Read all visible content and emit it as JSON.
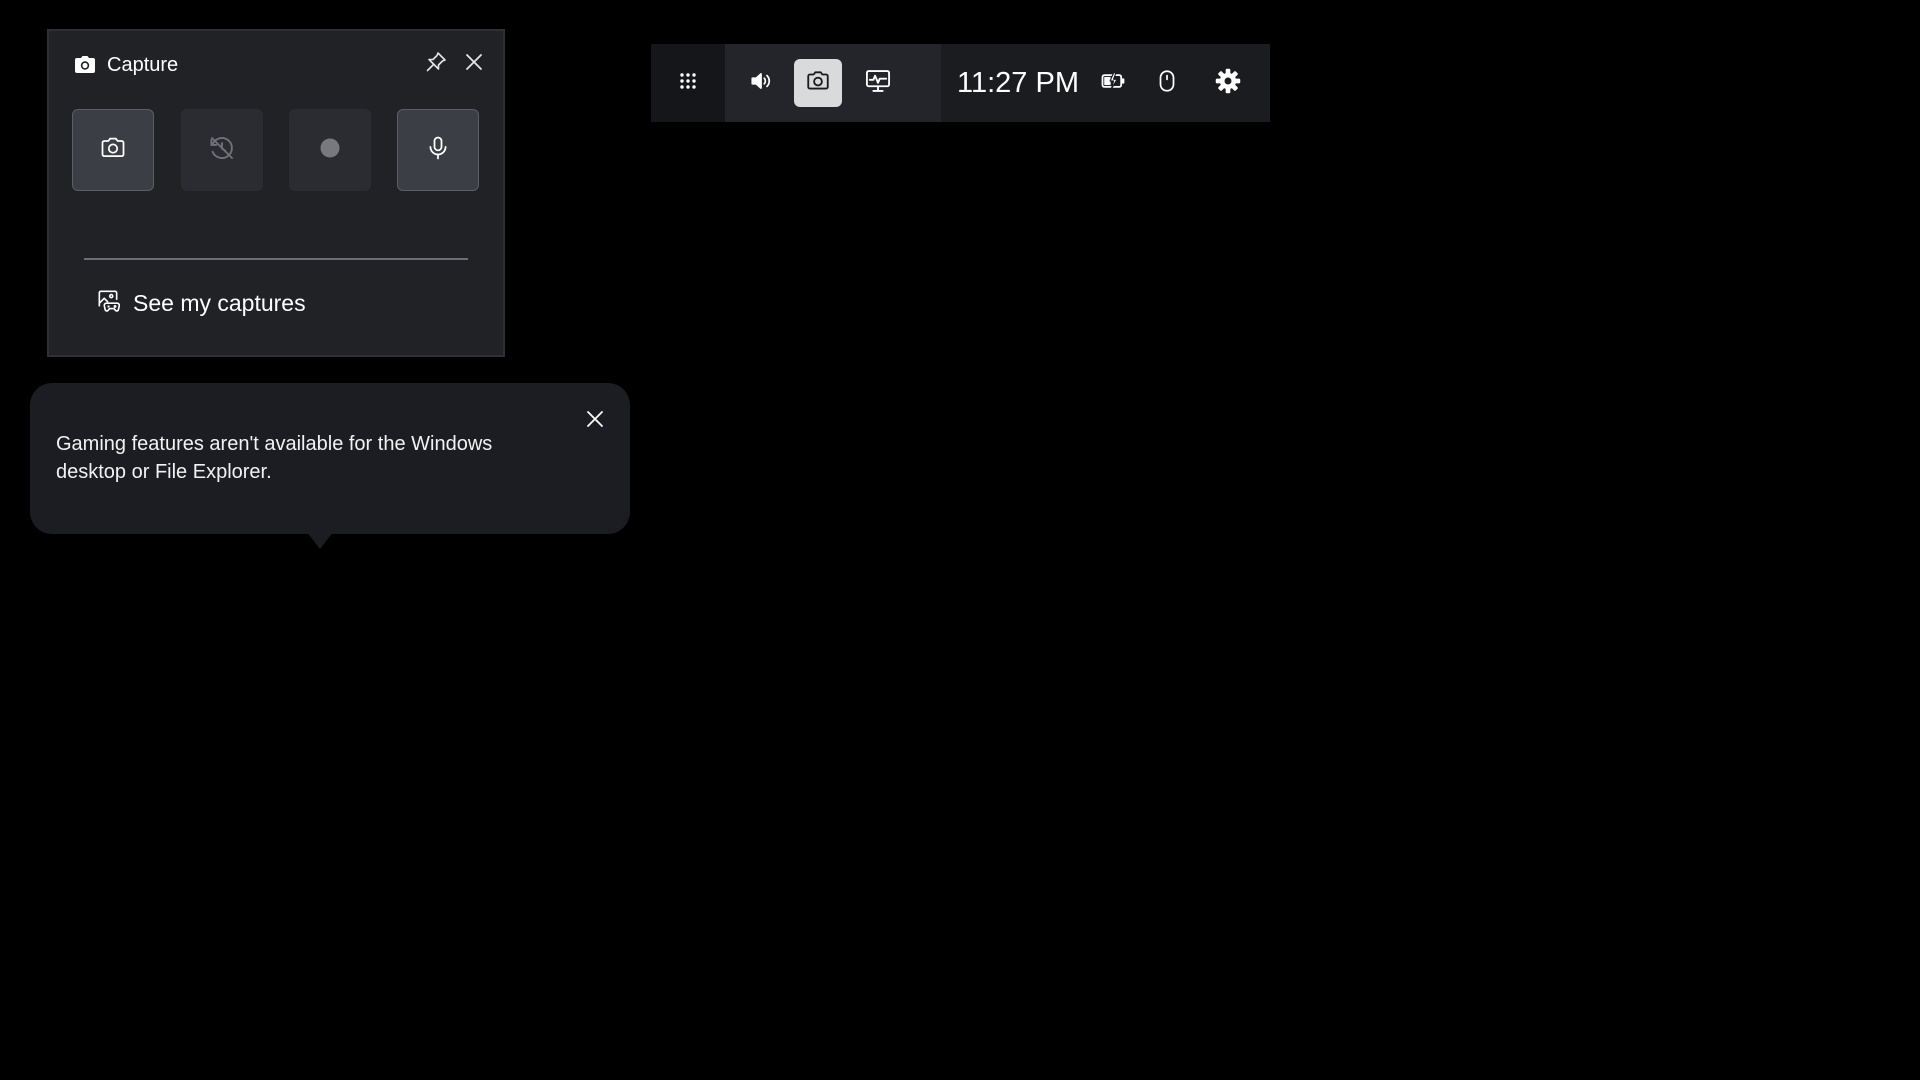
{
  "capture_widget": {
    "title": "Capture",
    "header_icon": "camera-icon",
    "pin_icon": "pin-icon",
    "close_icon": "close-icon",
    "buttons": [
      {
        "id": "screenshot",
        "icon": "camera-icon"
      },
      {
        "id": "record-last-30s",
        "icon": "history-off-icon"
      },
      {
        "id": "start-recording",
        "icon": "record-dot-icon"
      },
      {
        "id": "microphone",
        "icon": "microphone-icon"
      }
    ],
    "see_captures_label": "See my captures",
    "see_captures_icon": "gallery-controller-icon"
  },
  "notification": {
    "message": "Gaming features aren't available for the Windows desktop or File Explorer.",
    "close_icon": "close-icon"
  },
  "top_bar": {
    "menu_icon": "widget-menu-icon",
    "widgets": [
      {
        "id": "audio",
        "icon": "speaker-icon"
      },
      {
        "id": "capture",
        "icon": "camera-icon",
        "active": true
      },
      {
        "id": "performance",
        "icon": "performance-monitor-icon"
      }
    ],
    "clock": "11:27 PM",
    "status_icons": [
      "battery-charging-icon",
      "mouse-icon"
    ],
    "settings_icon": "gear-icon"
  },
  "colors": {
    "background": "#000000",
    "panel": "#202226",
    "toast": "#1c1d22",
    "active_widget": "#d9dadc"
  }
}
